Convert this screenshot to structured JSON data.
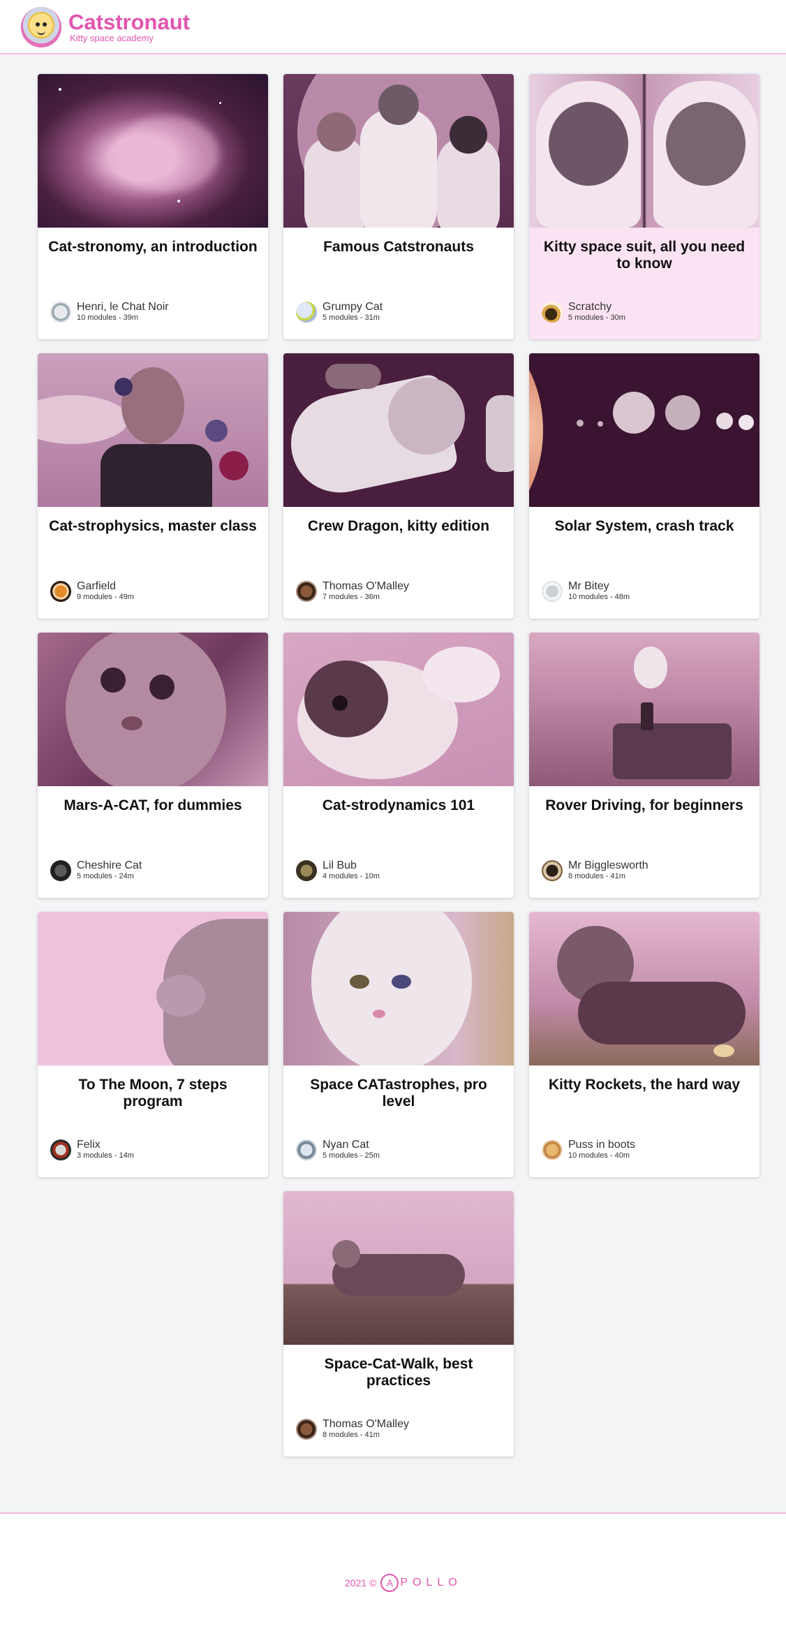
{
  "header": {
    "brand_title": "Catstronaut",
    "brand_subtitle": "Kitty space academy"
  },
  "tracks": [
    {
      "title": "Cat-stronomy, an introduction",
      "author": "Henri, le Chat Noir",
      "meta": "10 modules - 39m",
      "thumb": "nebula"
    },
    {
      "title": "Famous Catstronauts",
      "author": "Grumpy Cat",
      "meta": "5 modules - 31m",
      "thumb": "astronaut-cats"
    },
    {
      "title": "Kitty space suit, all you need to know",
      "author": "Scratchy",
      "meta": "5 modules - 30m",
      "thumb": "helmet-cats"
    },
    {
      "title": "Cat-strophysics, master class",
      "author": "Garfield",
      "meta": "9 modules - 49m",
      "thumb": "suit-cat-planets"
    },
    {
      "title": "Crew Dragon, kitty edition",
      "author": "Thomas O'Malley",
      "meta": "7 modules - 36m",
      "thumb": "crew-dragon"
    },
    {
      "title": "Solar System, crash track",
      "author": "Mr Bitey",
      "meta": "10 modules - 48m",
      "thumb": "solar-system"
    },
    {
      "title": "Mars-A-CAT, for dummies",
      "author": "Cheshire Cat",
      "meta": "5 modules - 24m",
      "thumb": "tabby-closeup"
    },
    {
      "title": "Cat-strodynamics 101",
      "author": "Lil Bub",
      "meta": "4 modules - 10m",
      "thumb": "white-cat-bed"
    },
    {
      "title": "Rover Driving, for beginners",
      "author": "Mr Bigglesworth",
      "meta": "8 modules - 41m",
      "thumb": "mars-rover"
    },
    {
      "title": "To The Moon, 7 steps program",
      "author": "Felix",
      "meta": "3 modules - 14m",
      "thumb": "grey-cat-profile"
    },
    {
      "title": "Space CATastrophes, pro level",
      "author": "Nyan Cat",
      "meta": "5 modules - 25m",
      "thumb": "white-fluffy-cat"
    },
    {
      "title": "Kitty Rockets, the hard way",
      "author": "Puss in boots",
      "meta": "10 modules - 40m",
      "thumb": "kitten-lying"
    },
    {
      "title": "Space-Cat-Walk, best practices",
      "author": "Thomas O'Malley",
      "meta": "8 modules - 41m",
      "thumb": "cat-on-fence"
    }
  ],
  "footer": {
    "copyright": "2021 ©",
    "logo_a": "A",
    "logo_rest": "POLLO"
  },
  "colors": {
    "brand_pink": "#e255b0",
    "header_border": "#f5b8d9",
    "page_bg": "#f3f4f6",
    "highlight_card": "#fce3f3"
  }
}
